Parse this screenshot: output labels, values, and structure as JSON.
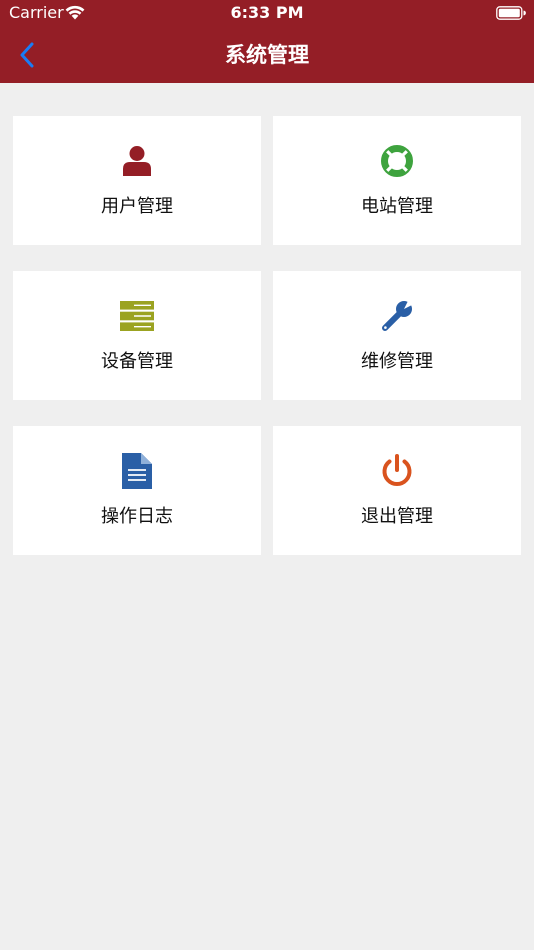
{
  "status_bar": {
    "carrier": "Carrier",
    "time": "6:33 PM"
  },
  "nav": {
    "title": "系统管理",
    "back_icon": "chevron-left-icon",
    "back_color": "#1a7cf5"
  },
  "colors": {
    "header_bg": "#941e26",
    "page_bg": "#efefef",
    "tile_bg": "#ffffff"
  },
  "tiles": [
    {
      "label": "用户管理",
      "icon": "user-icon",
      "color": "#941e26"
    },
    {
      "label": "电站管理",
      "icon": "life-ring-icon",
      "color": "#3ea33e"
    },
    {
      "label": "设备管理",
      "icon": "server-icon",
      "color": "#9ba321"
    },
    {
      "label": "维修管理",
      "icon": "wrench-icon",
      "color": "#2a5fa6"
    },
    {
      "label": "操作日志",
      "icon": "document-icon",
      "color": "#2a5fa6"
    },
    {
      "label": "退出管理",
      "icon": "power-icon",
      "color": "#d9531e"
    }
  ]
}
